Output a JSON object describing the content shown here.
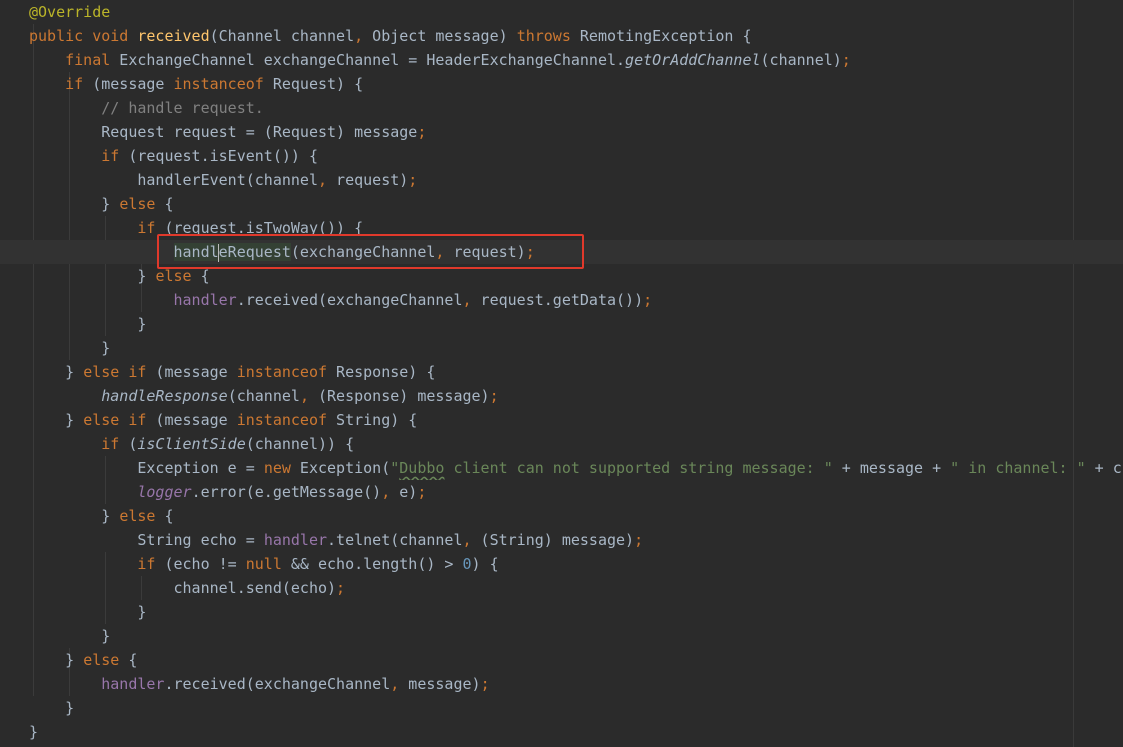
{
  "editor": {
    "colors": {
      "background": "#2b2b2b",
      "keyword": "#cc7832",
      "annotation": "#bbb529",
      "method_declaration": "#ffc66d",
      "field": "#9876aa",
      "comment": "#808080",
      "string": "#6a8759",
      "number": "#6897bb",
      "default_text": "#a9b7c6",
      "callout_box": "#e0392b"
    },
    "current_line_index": 10,
    "callout_box_around_line": 10,
    "lines": [
      [
        {
          "t": "@Override",
          "c": "ann"
        }
      ],
      [
        {
          "t": "public",
          "c": "kw"
        },
        {
          "t": " "
        },
        {
          "t": "void",
          "c": "kw"
        },
        {
          "t": " "
        },
        {
          "t": "received",
          "c": "fn-decl"
        },
        {
          "t": "(Channel channel"
        },
        {
          "t": ",",
          "c": "semi"
        },
        {
          "t": " Object message) "
        },
        {
          "t": "throws",
          "c": "kw"
        },
        {
          "t": " RemotingException {"
        }
      ],
      [
        {
          "t": "    "
        },
        {
          "t": "final",
          "c": "kw"
        },
        {
          "t": " ExchangeChannel exchangeChannel = HeaderExchangeChannel."
        },
        {
          "t": "getOrAddChannel",
          "c": "italic"
        },
        {
          "t": "(channel)"
        },
        {
          "t": ";",
          "c": "semi"
        }
      ],
      [
        {
          "t": "    "
        },
        {
          "t": "if",
          "c": "kw"
        },
        {
          "t": " (message "
        },
        {
          "t": "instanceof",
          "c": "kw"
        },
        {
          "t": " Request) {"
        }
      ],
      [
        {
          "t": "        "
        },
        {
          "t": "// handle request.",
          "c": "comment"
        }
      ],
      [
        {
          "t": "        Request request = (Request) message"
        },
        {
          "t": ";",
          "c": "semi"
        }
      ],
      [
        {
          "t": "        "
        },
        {
          "t": "if",
          "c": "kw"
        },
        {
          "t": " (request.isEvent()) {"
        }
      ],
      [
        {
          "t": "            handlerEvent(channel"
        },
        {
          "t": ",",
          "c": "semi"
        },
        {
          "t": " request)"
        },
        {
          "t": ";",
          "c": "semi"
        }
      ],
      [
        {
          "t": "        } "
        },
        {
          "t": "else",
          "c": "kw"
        },
        {
          "t": " {"
        }
      ],
      [
        {
          "t": "            "
        },
        {
          "t": "if",
          "c": "kw"
        },
        {
          "t": " (request.isTwoWay()) {"
        }
      ],
      [
        {
          "t": "                "
        },
        {
          "t": "handl",
          "c": "usage-hl"
        },
        {
          "caret": true
        },
        {
          "t": "eRequest",
          "c": "usage-hl"
        },
        {
          "t": "(exchangeChannel"
        },
        {
          "t": ",",
          "c": "semi"
        },
        {
          "t": " request)"
        },
        {
          "t": ";",
          "c": "semi"
        }
      ],
      [
        {
          "t": "            } "
        },
        {
          "t": "else",
          "c": "kw"
        },
        {
          "t": " {"
        }
      ],
      [
        {
          "t": "                "
        },
        {
          "t": "handler",
          "c": "field"
        },
        {
          "t": ".received(exchangeChannel"
        },
        {
          "t": ",",
          "c": "semi"
        },
        {
          "t": " request.getData())"
        },
        {
          "t": ";",
          "c": "semi"
        }
      ],
      [
        {
          "t": "            }"
        }
      ],
      [
        {
          "t": "        }"
        }
      ],
      [
        {
          "t": "    } "
        },
        {
          "t": "else if",
          "c": "kw"
        },
        {
          "t": " (message "
        },
        {
          "t": "instanceof",
          "c": "kw"
        },
        {
          "t": " Response) {"
        }
      ],
      [
        {
          "t": "        "
        },
        {
          "t": "handleResponse",
          "c": "italic"
        },
        {
          "t": "(channel"
        },
        {
          "t": ",",
          "c": "semi"
        },
        {
          "t": " (Response) message)"
        },
        {
          "t": ";",
          "c": "semi"
        }
      ],
      [
        {
          "t": "    } "
        },
        {
          "t": "else if",
          "c": "kw"
        },
        {
          "t": " (message "
        },
        {
          "t": "instanceof",
          "c": "kw"
        },
        {
          "t": " String) {"
        }
      ],
      [
        {
          "t": "        "
        },
        {
          "t": "if",
          "c": "kw"
        },
        {
          "t": " ("
        },
        {
          "t": "isClientSide",
          "c": "italic"
        },
        {
          "t": "(channel)) {"
        }
      ],
      [
        {
          "t": "            Exception e = "
        },
        {
          "t": "new",
          "c": "kw"
        },
        {
          "t": " Exception("
        },
        {
          "t": "\"",
          "c": "str"
        },
        {
          "t": "Dubbo",
          "c": "str wavy"
        },
        {
          "t": " client can not supported string message: \"",
          "c": "str"
        },
        {
          "t": " + message + "
        },
        {
          "t": "\" in channel: \"",
          "c": "str"
        },
        {
          "t": " + ch"
        }
      ],
      [
        {
          "t": "            "
        },
        {
          "t": "logger",
          "c": "field italic"
        },
        {
          "t": ".error(e.getMessage()"
        },
        {
          "t": ",",
          "c": "semi"
        },
        {
          "t": " e)"
        },
        {
          "t": ";",
          "c": "semi"
        }
      ],
      [
        {
          "t": "        } "
        },
        {
          "t": "else",
          "c": "kw"
        },
        {
          "t": " {"
        }
      ],
      [
        {
          "t": "            String echo = "
        },
        {
          "t": "handler",
          "c": "field"
        },
        {
          "t": ".telnet(channel"
        },
        {
          "t": ",",
          "c": "semi"
        },
        {
          "t": " (String) message)"
        },
        {
          "t": ";",
          "c": "semi"
        }
      ],
      [
        {
          "t": "            "
        },
        {
          "t": "if",
          "c": "kw"
        },
        {
          "t": " (echo != "
        },
        {
          "t": "null",
          "c": "kw"
        },
        {
          "t": " && echo.length() > "
        },
        {
          "t": "0",
          "c": "num"
        },
        {
          "t": ") {"
        }
      ],
      [
        {
          "t": "                channel.send(echo)"
        },
        {
          "t": ";",
          "c": "semi"
        }
      ],
      [
        {
          "t": "            }"
        }
      ],
      [
        {
          "t": "        }"
        }
      ],
      [
        {
          "t": "    } "
        },
        {
          "t": "else",
          "c": "kw"
        },
        {
          "t": " {"
        }
      ],
      [
        {
          "t": "        "
        },
        {
          "t": "handler",
          "c": "field"
        },
        {
          "t": ".received(exchangeChannel"
        },
        {
          "t": ",",
          "c": "semi"
        },
        {
          "t": " message)"
        },
        {
          "t": ";",
          "c": "semi"
        }
      ],
      [
        {
          "t": "    }"
        }
      ],
      [
        {
          "t": "}"
        }
      ]
    ]
  }
}
